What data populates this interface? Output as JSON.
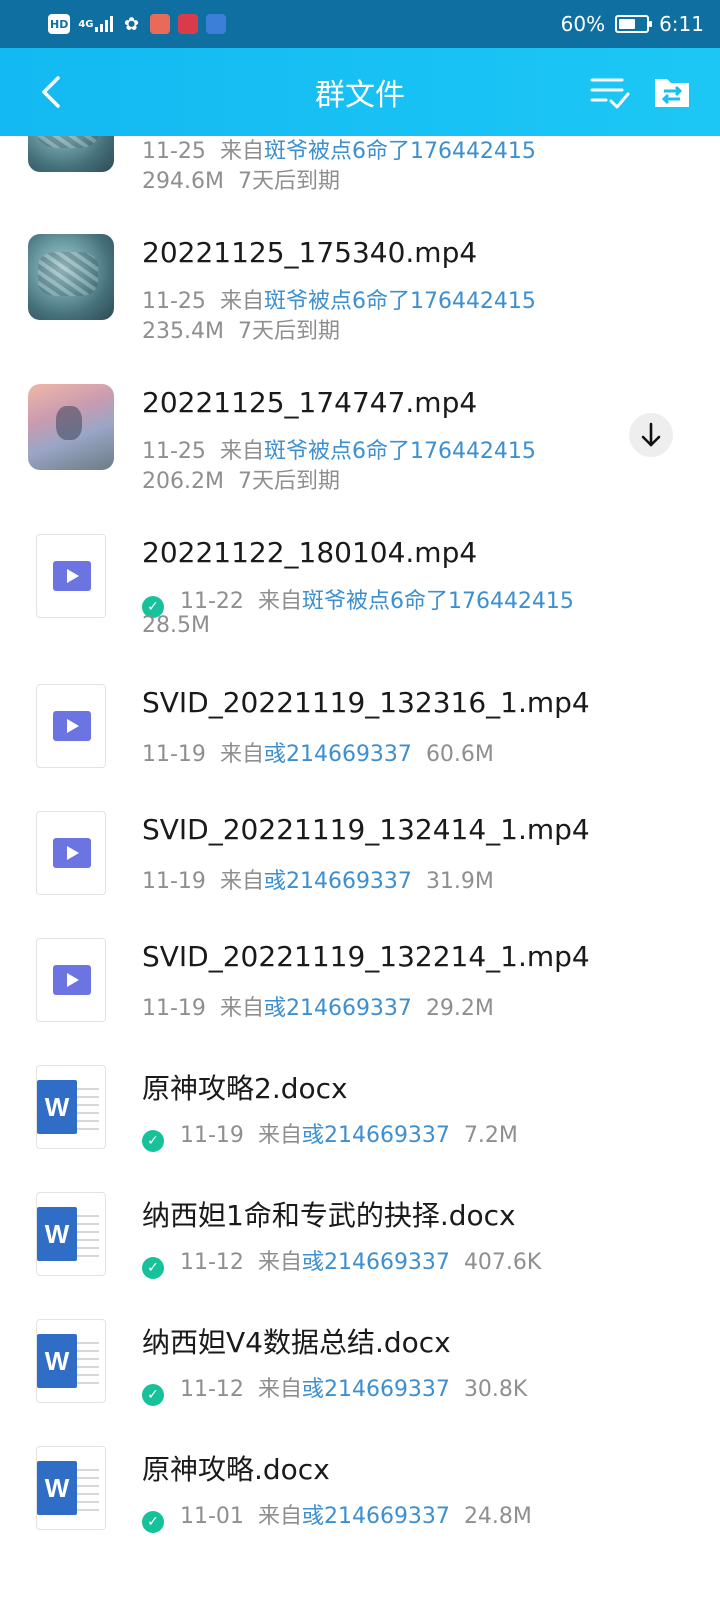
{
  "status_bar": {
    "hd_label": "HD",
    "network_label": "4G",
    "battery_text": "60%",
    "battery_level": 0.6,
    "time": "6:11"
  },
  "header": {
    "title": "群文件",
    "back_icon": "chevron-left-icon",
    "sort_icon": "sort-check-icon",
    "folder_icon": "folder-transfer-icon"
  },
  "colors": {
    "status_bar": "#0f6fa0",
    "app_bar": "#13b9f2",
    "link": "#3d8fcf",
    "check": "#17c29a",
    "word": "#2f6dc7",
    "video": "#6b74e0"
  },
  "files": [
    {
      "name": "",
      "date": "11-25",
      "from_label": "来自",
      "uploader": "斑爷被点6命了176442415",
      "size": "294.6M",
      "expiry": "7天后到期",
      "thumb": "game-map-thumbnail"
    },
    {
      "name": "20221125_175340.mp4",
      "date": "11-25",
      "from_label": "来自",
      "uploader": "斑爷被点6命了176442415",
      "size": "235.4M",
      "expiry": "7天后到期",
      "thumb": "game-map-thumbnail"
    },
    {
      "name": "20221125_174747.mp4",
      "date": "11-25",
      "from_label": "来自",
      "uploader": "斑爷被点6命了176442415",
      "size": "206.2M",
      "expiry": "7天后到期",
      "thumb": "game-character-thumbnail"
    },
    {
      "name": "20221122_180104.mp4",
      "date": "11-22",
      "from_label": "来自",
      "uploader": "斑爷被点6命了176442415",
      "size": "28.5M",
      "downloaded": true,
      "icon": "video-file-icon"
    },
    {
      "name": "SVID_20221119_132316_1.mp4",
      "date": "11-19",
      "from_label": "来自",
      "uploader": "彧214669337",
      "size": "60.6M",
      "icon": "video-file-icon"
    },
    {
      "name": "SVID_20221119_132414_1.mp4",
      "date": "11-19",
      "from_label": "来自",
      "uploader": "彧214669337",
      "size": "31.9M",
      "icon": "video-file-icon"
    },
    {
      "name": "SVID_20221119_132214_1.mp4",
      "date": "11-19",
      "from_label": "来自",
      "uploader": "彧214669337",
      "size": "29.2M",
      "icon": "video-file-icon"
    },
    {
      "name": "原神攻略2.docx",
      "date": "11-19",
      "from_label": "来自",
      "uploader": "彧214669337",
      "size": "7.2M",
      "downloaded": true,
      "icon": "word-file-icon"
    },
    {
      "name": "纳西妲1命和专武的抉择.docx",
      "date": "11-12",
      "from_label": "来自",
      "uploader": "彧214669337",
      "size": "407.6K",
      "downloaded": true,
      "icon": "word-file-icon"
    },
    {
      "name": "纳西妲V4数据总结.docx",
      "date": "11-12",
      "from_label": "来自",
      "uploader": "彧214669337",
      "size": "30.8K",
      "downloaded": true,
      "icon": "word-file-icon"
    },
    {
      "name": "原神攻略.docx",
      "date": "11-01",
      "from_label": "来自",
      "uploader": "彧214669337",
      "size": "24.8M",
      "downloaded": true,
      "icon": "word-file-icon"
    }
  ],
  "download_button": {
    "icon": "arrow-down-icon"
  }
}
